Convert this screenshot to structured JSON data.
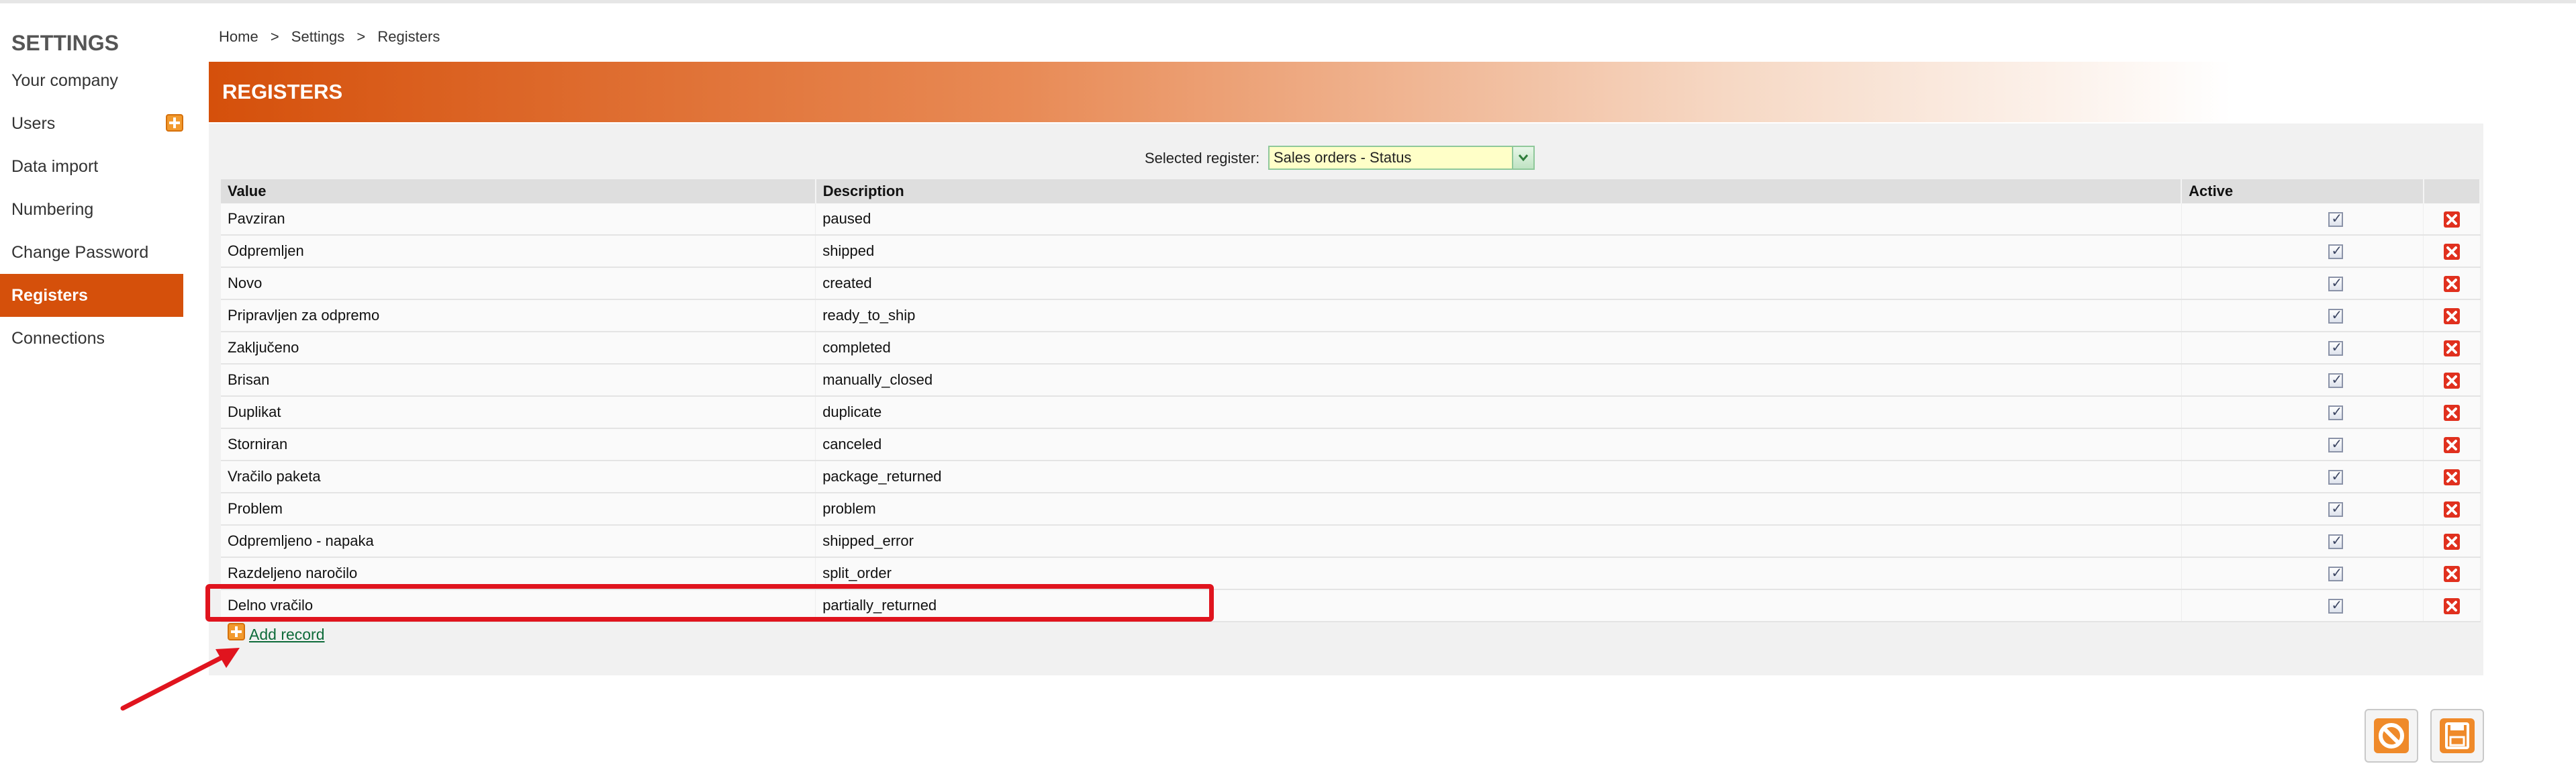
{
  "sidebar": {
    "title": "SETTINGS",
    "items": [
      {
        "label": "Your company"
      },
      {
        "label": "Users"
      },
      {
        "label": "Data import"
      },
      {
        "label": "Numbering"
      },
      {
        "label": "Change Password"
      },
      {
        "label": "Registers"
      },
      {
        "label": "Connections"
      }
    ],
    "active_item": "Registers"
  },
  "breadcrumb": {
    "items": [
      "Home",
      "Settings",
      "Registers"
    ],
    "separator": ">"
  },
  "header": {
    "title": "REGISTERS"
  },
  "selector": {
    "label": "Selected register:",
    "value": "Sales orders - Status"
  },
  "table": {
    "columns": [
      "Value",
      "Description",
      "Active"
    ],
    "rows": [
      {
        "value": "Pavziran",
        "description": "paused",
        "active": true
      },
      {
        "value": "Odpremljen",
        "description": "shipped",
        "active": true
      },
      {
        "value": "Novo",
        "description": "created",
        "active": true
      },
      {
        "value": "Pripravljen za odpremo",
        "description": "ready_to_ship",
        "active": true
      },
      {
        "value": "Zaključeno",
        "description": "completed",
        "active": true
      },
      {
        "value": "Brisan",
        "description": "manually_closed",
        "active": true
      },
      {
        "value": "Duplikat",
        "description": "duplicate",
        "active": true
      },
      {
        "value": "Storniran",
        "description": "canceled",
        "active": true
      },
      {
        "value": "Vračilo paketa",
        "description": "package_returned",
        "active": true
      },
      {
        "value": "Problem",
        "description": "problem",
        "active": true
      },
      {
        "value": "Odpremljeno - napaka",
        "description": "shipped_error",
        "active": true
      },
      {
        "value": "Razdeljeno naročilo",
        "description": "split_order",
        "active": true
      },
      {
        "value": "Delno vračilo",
        "description": "partially_returned",
        "active": true
      }
    ]
  },
  "add_record": {
    "label": "Add record"
  },
  "icons": {
    "add": "plus-square-icon",
    "delete": "red-x-icon",
    "cancel": "ban-icon",
    "save": "floppy-disk-icon",
    "dropdown": "chevron-down-icon"
  },
  "colors": {
    "accent": "#d5500b",
    "delete": "#e0301e",
    "annotation": "#e0141e",
    "link": "#0e6b3a",
    "selector_bg": "#ffffc8"
  }
}
